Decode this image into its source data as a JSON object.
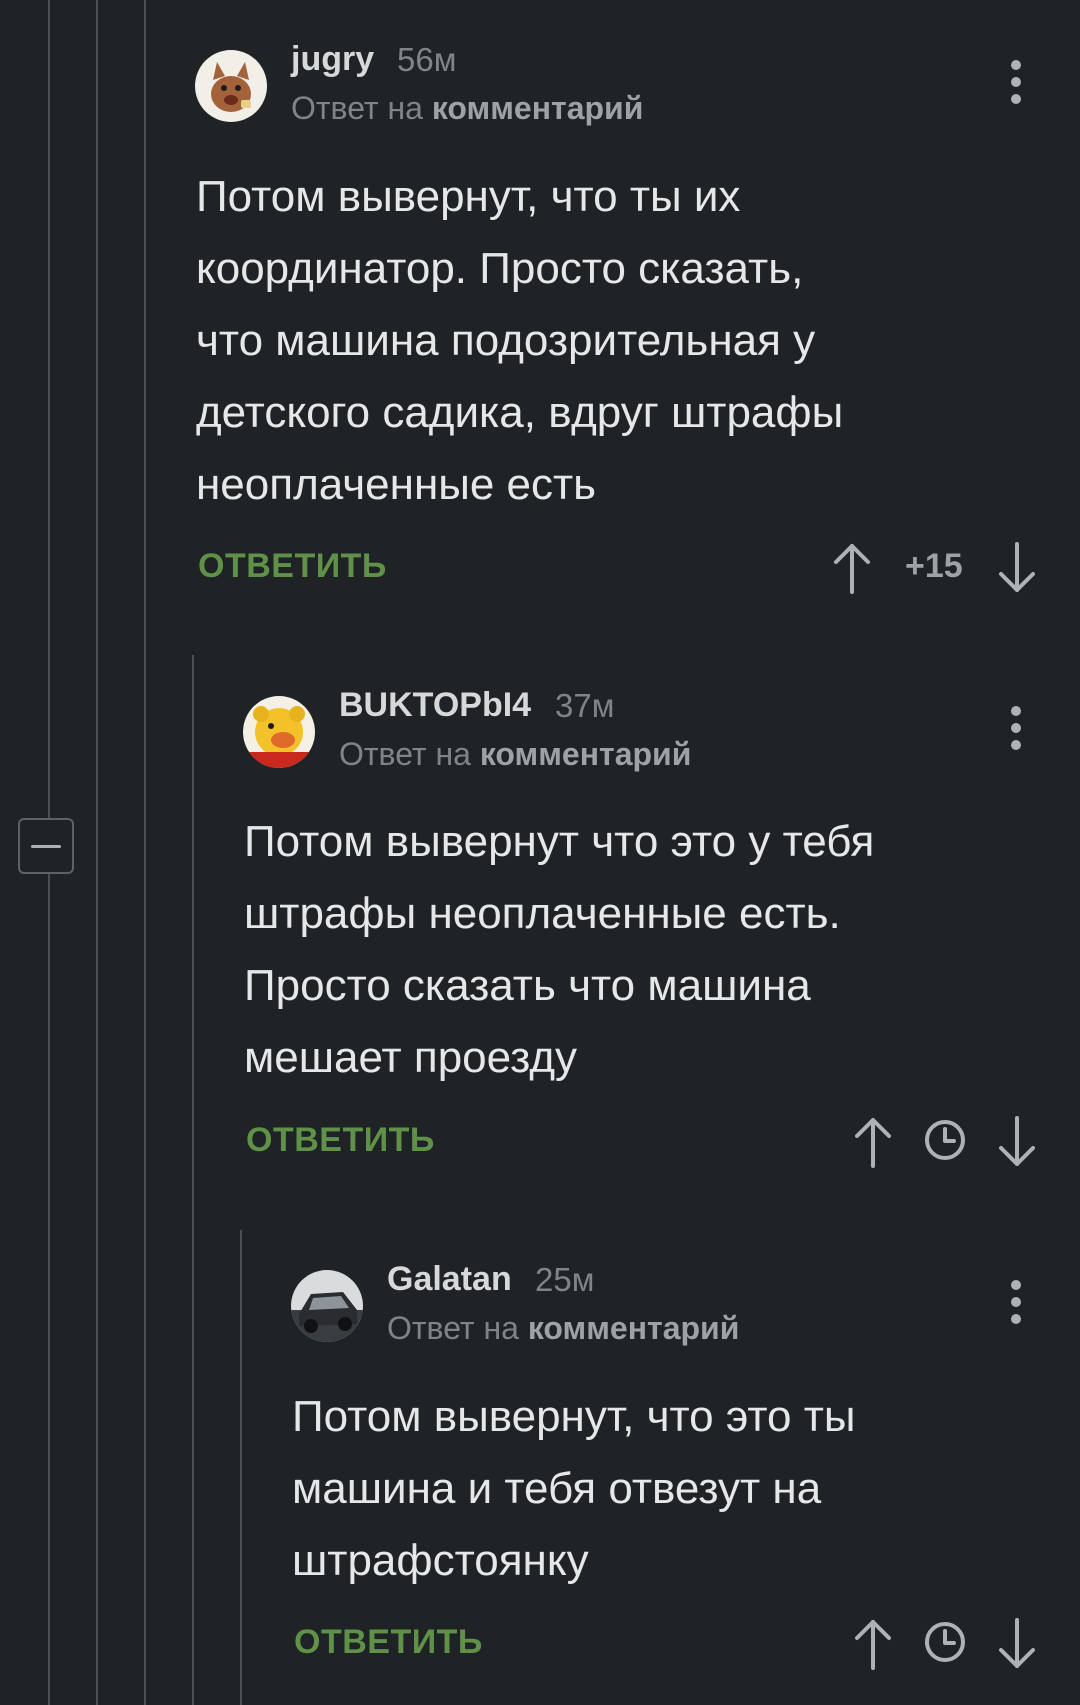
{
  "comments": [
    {
      "username": "jugry",
      "time": "56м",
      "reply_prefix": "Ответ на",
      "reply_target": "комментарий",
      "lines": [
        "Потом вывернут, что ты их",
        "координатор. Просто сказать,",
        "что машина подозрительная у",
        "детского садика, вдруг штрафы",
        "неоплаченные есть"
      ],
      "reply_label": "ОТВЕТИТЬ",
      "rating": "+15",
      "avatar_icon": "cat-avatar-icon"
    },
    {
      "username": "BUKTOPbI4",
      "time": "37м",
      "reply_prefix": "Ответ на",
      "reply_target": "комментарий",
      "lines": [
        "Потом вывернут что это у тебя",
        "штрафы неоплаченные есть.",
        "Просто сказать что машина",
        "мешает проезду"
      ],
      "reply_label": "ОТВЕТИТЬ",
      "rating_icon": "clock-icon",
      "avatar_icon": "pooh-avatar-icon"
    },
    {
      "username": "Galatan",
      "time": "25м",
      "reply_prefix": "Ответ на",
      "reply_target": "комментарий",
      "lines": [
        "Потом вывернут, что это ты",
        "машина и тебя отвезут на",
        "штрафстоянку"
      ],
      "reply_label": "ОТВЕТИТЬ",
      "rating_icon": "clock-icon",
      "avatar_icon": "car-avatar-icon"
    }
  ],
  "colors": {
    "background": "#202326",
    "reply_green": "#5f9149",
    "muted": "#7f848a",
    "thread_line": "#4b5056"
  }
}
